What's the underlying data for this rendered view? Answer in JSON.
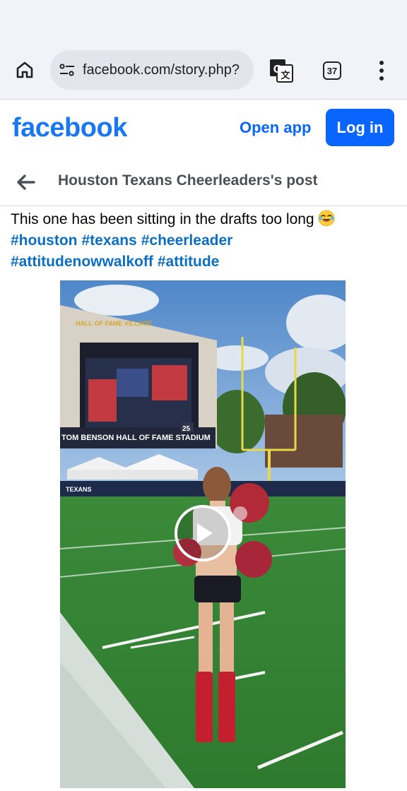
{
  "browser": {
    "url": "facebook.com/story.php?",
    "tab_count": "37",
    "icons": [
      "home-icon",
      "site-settings-icon",
      "translate-icon",
      "tabs-icon",
      "more-vert-icon"
    ]
  },
  "header": {
    "logo": "facebook",
    "open_app_label": "Open app",
    "login_label": "Log in",
    "brand_color": "#1877f2",
    "button_color": "#0866ff"
  },
  "post_bar": {
    "title": "Houston Texans Cheerleaders's post"
  },
  "post": {
    "text": "This one has been sitting in the drafts too long",
    "emoji": "laughing-crying-emoji",
    "hashtags": [
      "#houston",
      "#texans",
      "#cheerleader",
      "#attitudenowwalkoff",
      "#attitude"
    ],
    "hashtag_color": "#0a6fc2"
  },
  "video": {
    "stadium_sign": "TOM BENSON HALL OF FAME STADIUM",
    "venue_logo": "HALL OF FAME VILLAGE",
    "banner_text": "TEXANS",
    "screen_number": "25",
    "play_icon": "play-icon"
  }
}
